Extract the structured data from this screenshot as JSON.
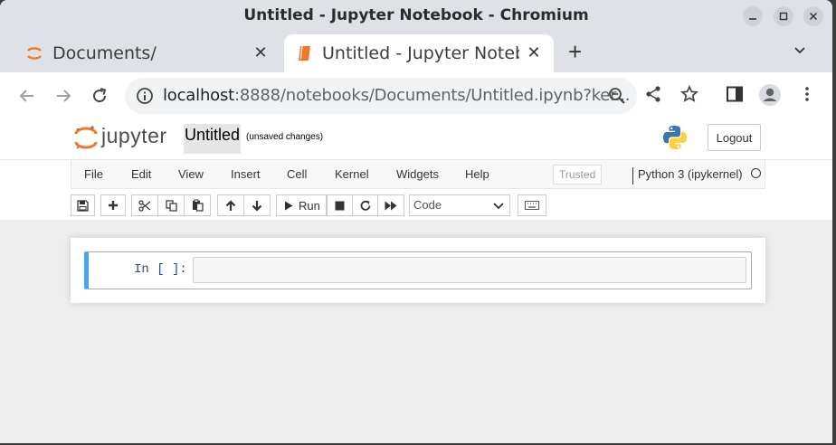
{
  "window": {
    "title": "Untitled - Jupyter Notebook - Chromium"
  },
  "tabs": [
    {
      "label": "Documents/",
      "icon": "jupyter-icon"
    },
    {
      "label": "Untitled - Jupyter Notebook",
      "icon": "notebook-icon",
      "active": true
    }
  ],
  "address": {
    "host": "localhost",
    "path": ":8888/notebooks/Documents/Untitled.ipynb?ker..."
  },
  "jupyter": {
    "brand": "jupyter",
    "notebook_name": "Untitled",
    "save_status": "(unsaved changes)",
    "logout_label": "Logout",
    "menus": [
      "File",
      "Edit",
      "View",
      "Insert",
      "Cell",
      "Kernel",
      "Widgets",
      "Help"
    ],
    "trusted_label": "Trusted",
    "kernel_name": "Python 3 (ipykernel)",
    "run_label": "Run",
    "cell_type": "Code",
    "prompt": "In [ ]:"
  },
  "colors": {
    "accent": "#42a5f5",
    "jupyter_orange": "#f37726",
    "prompt": "#303f9f"
  }
}
